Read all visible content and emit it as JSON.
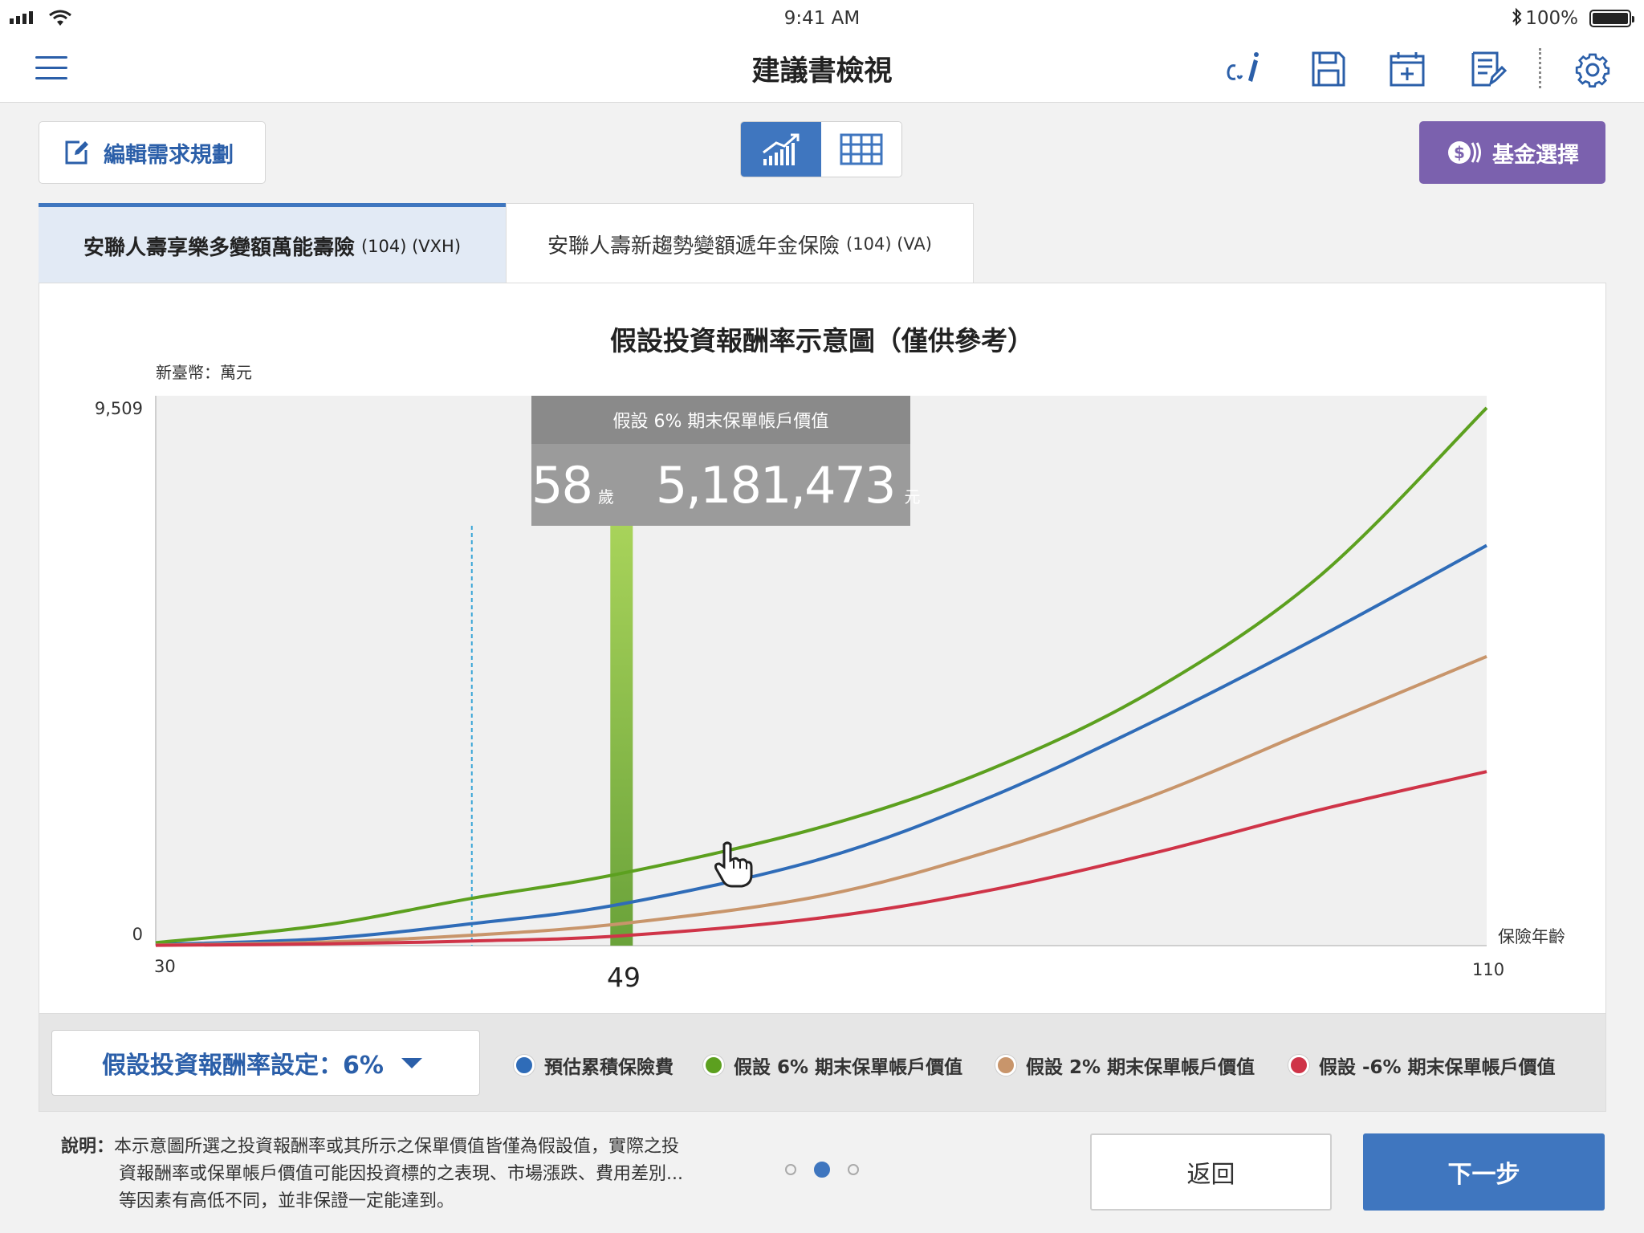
{
  "status_bar": {
    "time": "9:41 AM",
    "battery": "100%"
  },
  "nav": {
    "title": "建議書檢視",
    "icons": [
      "menu-icon",
      "ci-pen-icon",
      "save-icon",
      "calendar-add-icon",
      "document-edit-icon",
      "more-dots-icon",
      "gear-icon"
    ]
  },
  "toolbar": {
    "edit_label": "編輯需求規劃",
    "fund_label": "基金選擇",
    "view_modes": [
      "chart-view",
      "table-view"
    ],
    "active_view": "chart-view"
  },
  "tabs": [
    {
      "label": "安聯人壽享樂多變額萬能壽險",
      "code": "(104) (VXH)",
      "active": true
    },
    {
      "label": "安聯人壽新趨勢變額遞年金保險",
      "code": "(104) (VA)",
      "active": false
    }
  ],
  "tooltip": {
    "title": "假設 6% 期末保單帳戶價值",
    "age": "58",
    "age_unit": "歲",
    "value": "5,181,473",
    "value_unit": "元"
  },
  "rate_select": {
    "label": "假設投資報酬率設定：6%"
  },
  "chart_data": {
    "type": "line",
    "title": "假設投資報酬率示意圖（僅供參考）",
    "unit_label": "新臺幣：萬元",
    "xlabel": "保險年齡",
    "xlim": [
      30,
      110
    ],
    "ylim": [
      0,
      9509
    ],
    "ytick_labels": [
      "9,509",
      "0"
    ],
    "xtick_labels": [
      "30",
      "110"
    ],
    "x_marker": 49,
    "x_marker_label": "49",
    "highlight_x": 58,
    "x": [
      30,
      40,
      49,
      58,
      70,
      80,
      90,
      100,
      110
    ],
    "series": [
      {
        "name": "預估累積保險費",
        "color": "#2f6cb8",
        "values": [
          20,
          120,
          380,
          720,
          1500,
          2550,
          3880,
          5350,
          6920
        ]
      },
      {
        "name": "假設 6% 期末保單帳戶價值",
        "color": "#5ca01f",
        "values": [
          50,
          350,
          818,
          1250,
          2050,
          3030,
          4420,
          6400,
          9300
        ]
      },
      {
        "name": "假設 2% 期末保單帳戶價值",
        "color": "#c8956b",
        "values": [
          10,
          60,
          180,
          380,
          860,
          1620,
          2600,
          3800,
          5000
        ]
      },
      {
        "name": "假設 -6% 期末保單帳戶價值",
        "color": "#cf3448",
        "values": [
          5,
          30,
          80,
          170,
          480,
          950,
          1600,
          2350,
          3010
        ]
      }
    ],
    "legend_position": "bottom",
    "grid": false
  },
  "note": {
    "label": "說明：",
    "line1": "本示意圖所選之投資報酬率或其所示之保單價值皆僅為假設值，實際之投",
    "line2": "資報酬率或保單帳戶價值可能因投資標的之表現、市場漲跌、費用差別...",
    "line3": "等因素有高低不同，並非保證一定能達到。"
  },
  "pager": {
    "pages": 3,
    "current": 2
  },
  "footer": {
    "back_label": "返回",
    "next_label": "下一步"
  }
}
